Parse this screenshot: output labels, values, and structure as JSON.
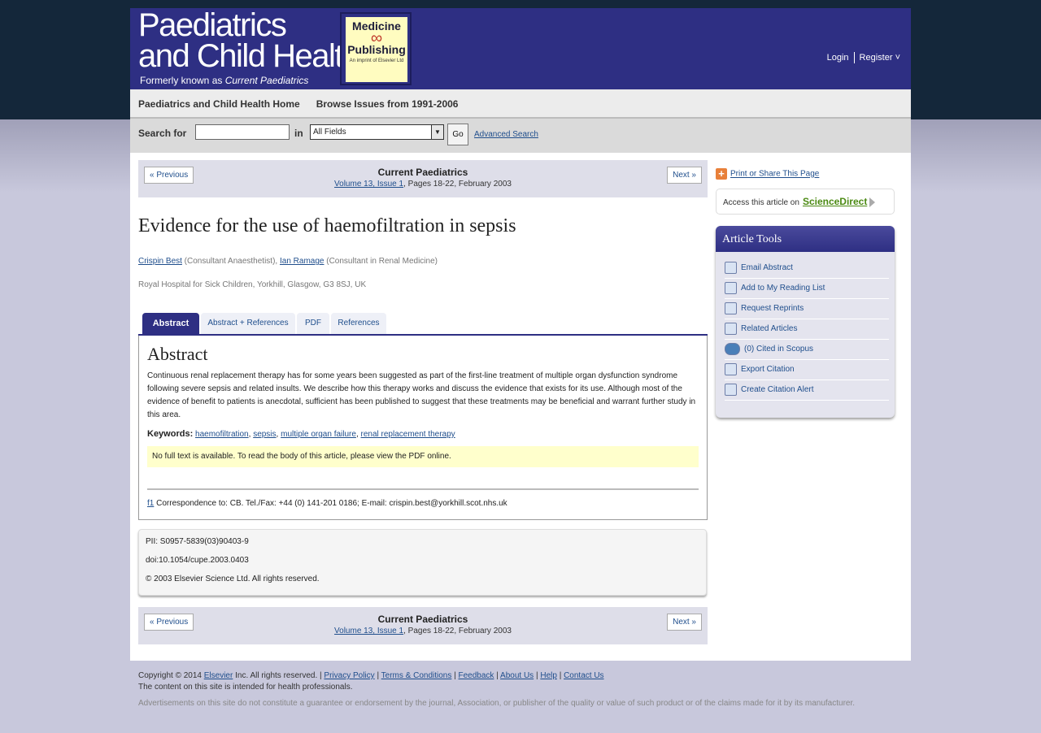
{
  "header": {
    "title_line1": "Paediatrics",
    "title_line2": "and Child Health",
    "subtitle_prefix": "Formerly known as ",
    "subtitle_journal": "Current Paediatrics",
    "badge_word1": "Medicine",
    "badge_word2": "Publishing",
    "badge_small": "An imprint of Elsevier Ltd",
    "login": "Login",
    "register": "Register"
  },
  "nav": {
    "home": "Paediatrics and Child Health Home",
    "browse": "Browse Issues from 1991-2006"
  },
  "search": {
    "label": "Search for",
    "in_label": "in",
    "field_value": "",
    "select_value": "All Fields",
    "go": "Go",
    "advanced": "Advanced Search"
  },
  "pager": {
    "previous": "« Previous",
    "next": "Next »",
    "journal": "Current Paediatrics",
    "issue_link": "Volume 13, Issue 1",
    "issue_rest": ", Pages 18-22, February 2003"
  },
  "article": {
    "title": "Evidence for the use of haemofiltration in sepsis",
    "author1": "Crispin Best",
    "author1_role": " (Consultant Anaesthetist), ",
    "author2": "Ian Ramage",
    "author2_role": " (Consultant in Renal Medicine)",
    "affiliation": "Royal Hospital for Sick Children, Yorkhill, Glasgow, G3 8SJ, UK"
  },
  "tabs": [
    "Abstract",
    "Abstract + References",
    "PDF",
    "References"
  ],
  "abstract": {
    "heading": "Abstract",
    "text": "Continuous renal replacement therapy has for some years been suggested as part of the first-line treatment of multiple organ dysfunction syndrome following severe sepsis and related insults. We describe how this therapy works and discuss the evidence that exists for its use. Although most of the evidence of benefit to patients is anecdotal, sufficient has been published to suggest that these treatments may be beneficial and warrant further study in this area.",
    "keywords_label": "Keywords:",
    "keywords": [
      "haemofiltration",
      "sepsis",
      "multiple organ failure",
      "renal replacement therapy"
    ],
    "note": "No full text is available. To read the body of this article, please view the PDF online.",
    "footnote_ref": "f1",
    "footnote": " Correspondence to: CB. Tel./Fax: +44 (0) 141-201 0186; E-mail: crispin.best@yorkhill.scot.nhs.uk"
  },
  "info": {
    "pii": "PII: S0957-5839(03)90403-9",
    "doi": "doi:10.1054/cupe.2003.0403",
    "copyright": "© 2003 Elsevier Science Ltd. All rights reserved."
  },
  "sidebar": {
    "print": "Print or Share This Page",
    "access_prefix": "Access this article on",
    "sciencedirect": "ScienceDirect",
    "tools_title": "Article Tools",
    "tools": [
      {
        "label": "Email Abstract",
        "icon": "email-icon"
      },
      {
        "label": "Add to My Reading List",
        "icon": "reading-list-icon"
      },
      {
        "label": "Request Reprints",
        "icon": "reprints-icon"
      },
      {
        "label": "Related Articles",
        "icon": "related-articles-icon"
      },
      {
        "label": "(0) Cited in Scopus",
        "icon": "scopus-icon"
      },
      {
        "label": "Export Citation",
        "icon": "export-icon"
      },
      {
        "label": "Create Citation Alert",
        "icon": "alert-icon"
      }
    ]
  },
  "footer": {
    "copyright_prefix": "Copyright © 2014 ",
    "elsevier": "Elsevier",
    "copyright_suffix": " Inc. All rights reserved. | ",
    "links": [
      "Privacy Policy",
      "Terms & Conditions",
      "Feedback",
      "About Us",
      "Help",
      "Contact Us"
    ],
    "line2": "The content on this site is intended for health professionals.",
    "disclaimer": "Advertisements on this site do not constitute a guarantee or endorsement by the journal, Association, or publisher of the quality or value of such product or of the claims made for it by its manufacturer."
  },
  "colors": {
    "brand": "#2e2f83",
    "link": "#1f4e8c",
    "note_bg": "#ffffcc",
    "sciencedirect": "#4b8a12"
  }
}
